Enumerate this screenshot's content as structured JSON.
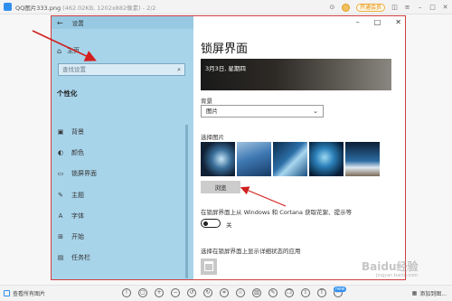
{
  "viewer": {
    "title": "QQ图片333.png",
    "meta": "(462.02KB, 1202x882像素) - 2/2",
    "vip_label": "开通会员",
    "bottom_left_label": "查看所有图片",
    "bottom_right_label": "添加到图...",
    "new_badge": "new"
  },
  "settings": {
    "window_title": "设置",
    "home_label": "主页",
    "search_placeholder": "查找设置",
    "section_title": "个性化",
    "nav_items": [
      {
        "label": "背景",
        "icon": "image-icon"
      },
      {
        "label": "颜色",
        "icon": "palette-icon"
      },
      {
        "label": "锁屏界面",
        "icon": "lock-screen-icon"
      },
      {
        "label": "主题",
        "icon": "brush-icon"
      },
      {
        "label": "字体",
        "icon": "font-icon"
      },
      {
        "label": "开始",
        "icon": "start-icon"
      },
      {
        "label": "任务栏",
        "icon": "taskbar-icon"
      }
    ],
    "page_title": "锁屏界面",
    "preview_date": "3月3日, 星期四",
    "background_label": "背景",
    "background_value": "图片",
    "choose_picture_label": "选择图片",
    "browse_label": "浏览",
    "cortana_text": "在锁屏界面上从 Windows 和 Cortana 获取花絮、提示等",
    "toggle_state": "关",
    "detail_status_text": "选择在锁屏界面上显示详细状态的应用"
  },
  "watermark": {
    "text": "Baidu经验",
    "sub": "jingyan.baidu.com"
  },
  "colors": {
    "left_panel": "#a8d4ea",
    "frame_border": "#d24040",
    "arrow": "#d22020"
  }
}
